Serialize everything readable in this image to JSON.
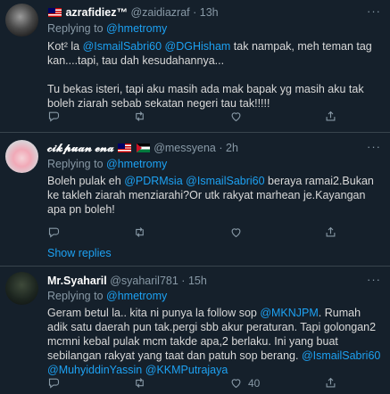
{
  "tweets": [
    {
      "name": "azrafidiez™",
      "handle": "@zaidiazraf",
      "time": "13h",
      "replying_label": "Replying to",
      "replying_to": "@hmetromy",
      "body_parts": [
        {
          "t": "Kot² la "
        },
        {
          "m": "@IsmailSabri60"
        },
        {
          "t": " "
        },
        {
          "m": "@DGHisham"
        },
        {
          "t": " tak nampak, meh teman tag kan....tapi, tau dah kesudahannya..."
        },
        {
          "br": true
        },
        {
          "br": true
        },
        {
          "t": "Tu bekas isteri, tapi aku masih ada mak bapak yg masih aku tak boleh ziarah sebab sekatan negeri  tau tak!!!!!"
        }
      ],
      "likes": ""
    },
    {
      "name": "𝓬𝓲𝓴𝓹𝓾𝓪𝓷 𝓮𝓷𝓪",
      "handle": "@messyena",
      "time": "2h",
      "replying_label": "Replying to",
      "replying_to": "@hmetromy",
      "body_parts": [
        {
          "t": "Boleh pulak eh "
        },
        {
          "m": "@PDRMsia"
        },
        {
          "t": " "
        },
        {
          "m": "@IsmailSabri60"
        },
        {
          "t": " beraya ramai2.Bukan ke takleh ziarah menziarahi?Or utk rakyat marhean je.Kayangan apa pn boleh!"
        }
      ],
      "likes": "",
      "show_replies": "Show replies"
    },
    {
      "name": "Mr.Syaharil",
      "handle": "@syaharil781",
      "time": "15h",
      "replying_label": "Replying to",
      "replying_to": "@hmetromy",
      "body_parts": [
        {
          "t": "Geram betul la.. kita ni punya la follow sop "
        },
        {
          "m": "@MKNJPM"
        },
        {
          "t": ". Rumah adik satu daerah pun tak.pergi sbb akur peraturan. Tapi golongan2 mcmni kebal pulak mcm takde apa,2 berlaku. Ini yang buat sebilangan rakyat yang taat dan patuh sop berang. "
        },
        {
          "m": "@IsmailSabri60"
        },
        {
          "t": " "
        },
        {
          "m": "@MuhyiddinYassin"
        },
        {
          "t": " "
        },
        {
          "m": "@KKMPutrajaya"
        }
      ],
      "likes": "40"
    }
  ],
  "icons": {
    "reply": "reply-icon",
    "retweet": "retweet-icon",
    "like": "heart-icon",
    "share": "share-icon",
    "more": "more-icon"
  },
  "colors": {
    "background": "#15202b",
    "accent": "#1da1f2",
    "muted": "#8899a6",
    "separator": "#38444d"
  }
}
